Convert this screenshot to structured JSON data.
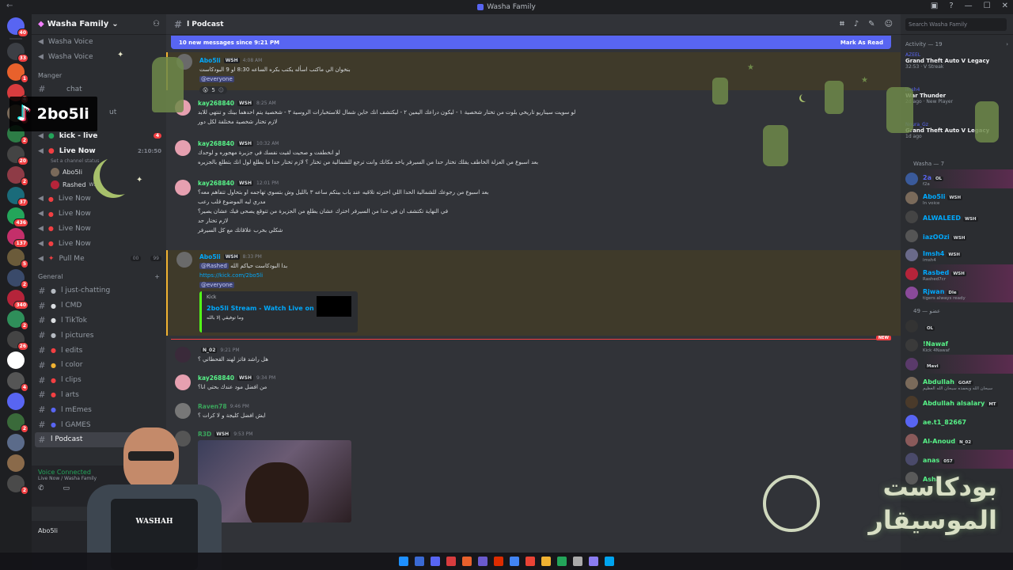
{
  "window": {
    "title": "Washa Family"
  },
  "servers": [
    {
      "color": "#5865f2",
      "badge": "40"
    },
    {
      "color": "#3c3f45",
      "badge": "33"
    },
    {
      "color": "#e8612c",
      "badge": "1"
    },
    {
      "color": "#d83c3e",
      "badge": "4"
    },
    {
      "color": "#7a6a5a",
      "badge": "1"
    },
    {
      "color": "#2d7d46",
      "badge": "2"
    },
    {
      "color": "#444",
      "badge": "20"
    },
    {
      "color": "#8e3b46",
      "badge": "2"
    },
    {
      "color": "#1a6b7a",
      "badge": "37"
    },
    {
      "color": "#23a55a",
      "badge": "436"
    },
    {
      "color": "#c42f6a",
      "badge": "137"
    },
    {
      "color": "#6b5b3a",
      "badge": "5"
    },
    {
      "color": "#3a4a6a",
      "badge": "2"
    },
    {
      "color": "#b5243a",
      "badge": "340"
    },
    {
      "color": "#2f8f5a",
      "badge": "2"
    },
    {
      "color": "#444",
      "badge": "26"
    },
    {
      "color": "#ffffff",
      "badge": ""
    },
    {
      "color": "#555",
      "badge": "4"
    },
    {
      "color": "#5865f2",
      "badge": ""
    },
    {
      "color": "#3a6a3a",
      "badge": "2"
    },
    {
      "color": "#5b6b8a",
      "badge": ""
    },
    {
      "color": "#8a6a4a",
      "badge": ""
    },
    {
      "color": "#4a4a4a",
      "badge": "2"
    }
  ],
  "guild": {
    "name": "Washa Family"
  },
  "sidebar": {
    "top_items": [
      "Washa Voice",
      "Washa Voice"
    ],
    "category_manager": "Manger",
    "chat_label": "chat",
    "out_label": "ut",
    "kick_live": "kick - live",
    "kick_badge": "4",
    "live_now": "Live Now",
    "live_time": "2:10:50",
    "set_status": "Set a channel status",
    "voice_users": [
      {
        "name": "Abo5li",
        "tag": ""
      },
      {
        "name": "Rashed",
        "tag": "WSH"
      }
    ],
    "more_live": [
      "Live Now",
      "Live Now",
      "Live Now",
      "Live Now"
    ],
    "pull_me": "Pull Me",
    "pull_counts": [
      "00",
      "99"
    ],
    "category_general": "General",
    "text_channels": [
      "l just-chatting",
      "l CMD",
      "l TikTok",
      "l pictures",
      "l edits",
      "l color",
      "l clips",
      "l arts",
      "l mEmes",
      "l GAMES"
    ],
    "active_channel": "l Podcast",
    "new_badge": "NEW"
  },
  "voice_panel": {
    "status": "Voice Connected",
    "sub": "Live Now / Washa Family"
  },
  "user_panel": {
    "name": "Abo5li"
  },
  "chat": {
    "channel": "l Podcast",
    "new_messages": "10 new messages since 9:21 PM",
    "mark_read": "Mark As Read",
    "new_divider": "NEW",
    "messages": [
      {
        "user": "Abo5li",
        "user_color": "#00a8fc",
        "tag": "WSH",
        "time": "4:08 AM",
        "lines": [
          "بنخوان الي ماكتب اسأله يكتب بكره الساعه 8:30 او 9 البودكاست"
        ],
        "mention": "@everyone",
        "reaction_count": "5"
      },
      {
        "user": "kay268840",
        "user_color": "#57f287",
        "tag": "WSH",
        "time": "8:25 AM",
        "lines": [
          "لو سويت سيناريو تاريخي بلوت من تختار شخصية ١ - ليكون دراعك اليمين ٢ - ليكتشف انك خاين شمال للاستخبارات الروسية ٣ - شخصية يتم احدهما بينك و تنتهي للابد",
          "لازم تختار شخصية مختلفة لكل دور"
        ]
      },
      {
        "user": "kay268840",
        "user_color": "#57f287",
        "tag": "WSH",
        "time": "10:32 AM",
        "lines": [
          "لو انخطفت و صحيت لقيت نفسك في جزيرة مهجوره و لوحدك",
          "بعد اسبوع من العزلة الخاطف يقلك تختار حدا من السيرفر ياخد مكانك وانت ترجع للشمالية من تختار ؟ لازم تختار حدا ما يطلع لول انك بتطلع بالجزيره"
        ]
      },
      {
        "user": "kay268840",
        "user_color": "#57f287",
        "tag": "WSH",
        "time": "12:01 PM",
        "lines": [
          "بعد اسبوع من رجوعك للشمالية الحدا اللي اخترته تلاقيه عند باب بيتكم ساعه ٣ بالليل وش بتسوي تهاجمه او بتحاول تتفاهم معه؟",
          "مدري ليه الموضوع قلب رعب",
          "في النهاية تكتشف ان في حدا من السيرفر اخترك عشان يطلع من الجزيرة من تتوقع يصحى فيك عشان يصير؟",
          "لازم تختار حد",
          "شكلي بخرب علاقاتك مع كل السيرفر"
        ]
      },
      {
        "user": "Abo5li",
        "user_color": "#00a8fc",
        "tag": "WSH",
        "time": "8:33 PM",
        "lines": [
          "بدا البودكاست حياكم الله"
        ],
        "mention_rashed": "@Rashed",
        "link": "https://kick.com/2bo5li",
        "mention": "@everyone",
        "embed": {
          "provider": "Kick",
          "title": "2bo5li Stream - Watch Live on Kick",
          "desc": "وما توفيقي إلا بالله"
        }
      },
      {
        "user": "",
        "user_color": "#949ba4",
        "tag": "N_02",
        "time": "9:21 PM",
        "lines": [
          "هل راشد فاتز لهند القحطاني ؟"
        ]
      },
      {
        "user": "kay268840",
        "user_color": "#57f287",
        "tag": "WSH",
        "time": "9:34 PM",
        "lines": [
          "من افضل مود عندك بحتي انا؟"
        ]
      },
      {
        "user": "Raven78",
        "user_color": "#3ba55c",
        "tag": "",
        "time": "9:46 PM",
        "lines": [
          "ايش افضل كليجة و لا كرات ؟"
        ]
      },
      {
        "user": "R3D",
        "user_color": "#3ba55c",
        "tag": "WSH",
        "time": "9:53 PM",
        "lines": []
      }
    ]
  },
  "members": {
    "search_placeholder": "Search Washa Family",
    "activity_header": "Activity — 19",
    "activities": [
      {
        "who": "AZEEL",
        "what": "Grand Theft Auto V Legacy",
        "when": "32:53 · V Streak"
      },
      {
        "who": "imsh4",
        "what": "War Thunder",
        "when": "2d ago · New Player"
      },
      {
        "who": "Noura_Gz",
        "what": "Grand Theft Auto V Legacy",
        "when": "1d ago"
      }
    ],
    "group1": "Washa — 7",
    "group1_members": [
      {
        "name": "2a",
        "color": "#5865f2",
        "tag": "OL",
        "sub": "f2a"
      },
      {
        "name": "Abo5li",
        "color": "#00a8fc",
        "tag": "WSH",
        "sub": "In voice"
      },
      {
        "name": "ALWALEED",
        "color": "#00a8fc",
        "tag": "WSH",
        "sub": ""
      },
      {
        "name": "iazOOzi",
        "color": "#00a8fc",
        "tag": "WSH",
        "sub": ""
      },
      {
        "name": "Imsh4",
        "color": "#00a8fc",
        "tag": "WSH",
        "sub": "imsh4"
      },
      {
        "name": "Rasbed",
        "color": "#00a8fc",
        "tag": "WSH",
        "sub": "Rashed7cr"
      },
      {
        "name": "Rjwan",
        "color": "#00a8fc",
        "tag": "Dle",
        "sub": "tigers always ready"
      }
    ],
    "group2": "عضو — 49",
    "group2_members": [
      {
        "name": "",
        "color": "#5865f2",
        "tag": "OL",
        "sub": ""
      },
      {
        "name": "!Nawaf",
        "color": "#57f287",
        "tag": "",
        "sub": "Kick 4Nawaf"
      },
      {
        "name": "",
        "color": "#5865f2",
        "tag": "Mavi",
        "sub": ""
      },
      {
        "name": "Abdullah",
        "color": "#57f287",
        "tag": "GOAT",
        "sub": "سبحان الله وبحمده سبحان الله العظيم"
      },
      {
        "name": "Abdullah alsalary",
        "color": "#57f287",
        "tag": "MT",
        "sub": ""
      },
      {
        "name": "ae.t1_82667",
        "color": "#57f287",
        "tag": "",
        "sub": ""
      },
      {
        "name": "Al-Anoud",
        "color": "#57f287",
        "tag": "N_02",
        "sub": ""
      },
      {
        "name": "anas",
        "color": "#57f287",
        "tag": "057",
        "sub": ""
      },
      {
        "name": "Asha",
        "color": "#57f287",
        "tag": "",
        "sub": ""
      }
    ]
  },
  "overlay": {
    "tiktok_handle": "2bo5li",
    "podcast_logo_line1": "بودكاست",
    "podcast_logo_line2": "الموسيقار",
    "figure_label": "WASHAH"
  }
}
